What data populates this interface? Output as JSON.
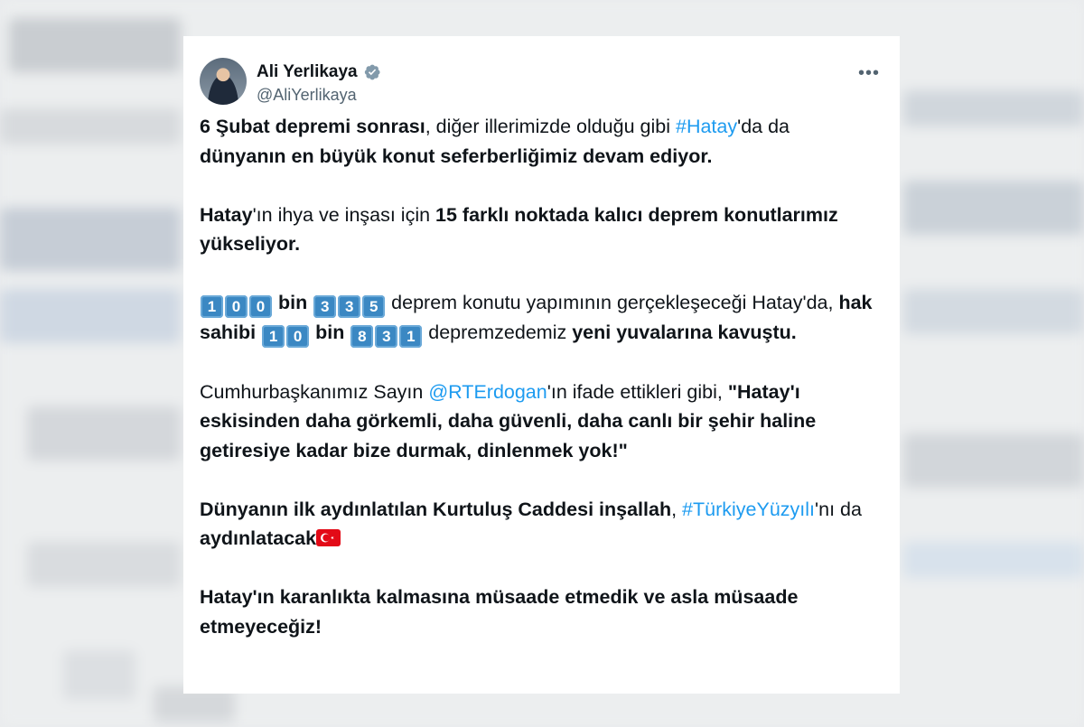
{
  "tweet": {
    "author": {
      "name": "Ali Yerlikaya",
      "handle": "@AliYerlikaya"
    },
    "more_label": "•••",
    "p1": {
      "a": "6 Şubat depremi sonrası",
      "b": ", diğer illerimizde olduğu gibi ",
      "hashtag": "#Hatay",
      "c": "'da da",
      "d": "dünyanın en büyük konut seferberliğimiz devam ediyor."
    },
    "p2": {
      "a": "Hatay",
      "b": "'ın ihya ve inşası için ",
      "c": "15 farklı noktada kalıcı deprem konutlarımız yükseliyor."
    },
    "p3": {
      "n1": [
        "1",
        "0",
        "0"
      ],
      "bin1": " bin ",
      "n2": [
        "3",
        "3",
        "5"
      ],
      "a": " deprem konutu yapımının gerçekleşeceği Hatay'da, ",
      "b": "hak sahibi ",
      "n3": [
        "1",
        "0"
      ],
      "bin2": " bin ",
      "n4": [
        "8",
        "3",
        "1"
      ],
      "c": " depremzedemiz ",
      "d": "yeni yuvalarına kavuştu."
    },
    "p4": {
      "a": "Cumhurbaşkanımız Sayın ",
      "mention": "@RTErdogan",
      "b": "'ın ifade ettikleri gibi, ",
      "quote": "\"Hatay'ı eskisinden daha görkemli, daha güvenli, daha canlı bir şehir haline getiresiye kadar bize durmak, dinlenmek yok!\""
    },
    "p5": {
      "a": "Dünyanın ilk aydınlatılan Kurtuluş Caddesi inşallah",
      "b": ", ",
      "hashtag": "#TürkiyeYüzyılı",
      "c": "'nı da ",
      "d": "aydınlatacak"
    },
    "p6": "Hatay'ın karanlıkta kalmasına müsaade etmedik ve asla müsaade etmeyeceğiz!"
  },
  "colors": {
    "link": "#1d9bf0",
    "verified": "#829aab",
    "keycap": "#3b88c3",
    "flag": "#e30a17"
  }
}
